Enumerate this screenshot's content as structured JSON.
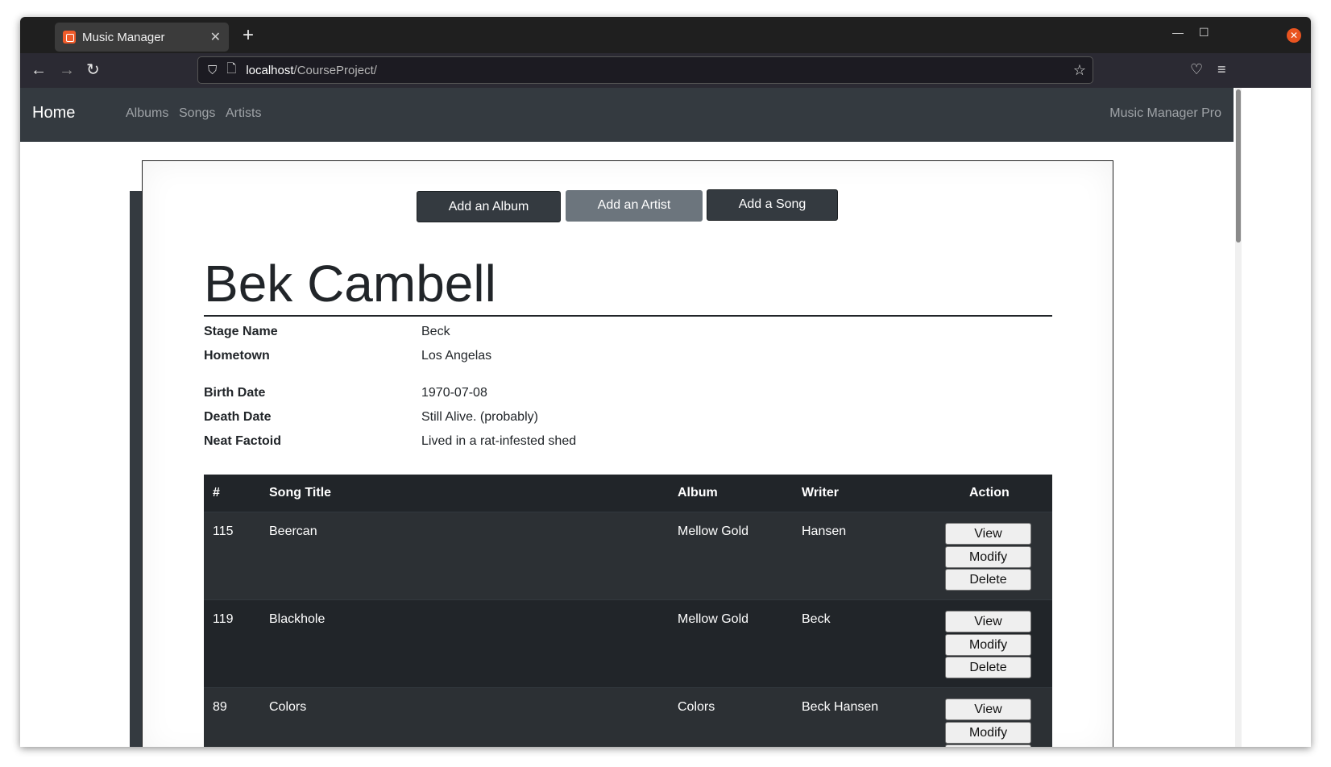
{
  "browser": {
    "tab_title": "Music Manager",
    "url_host": "localhost",
    "url_path": "/CourseProject/"
  },
  "site_nav": {
    "brand": "Home",
    "links": [
      "Albums",
      "Songs",
      "Artists"
    ],
    "right": "Music Manager Pro"
  },
  "actions": {
    "add_album": "Add an Album",
    "add_artist": "Add an Artist",
    "add_song": "Add a Song"
  },
  "artist": {
    "name": "Bek Cambell",
    "details": [
      {
        "label": "Stage Name",
        "value": "Beck"
      },
      {
        "label": "Hometown",
        "value": "Los Angelas"
      },
      {
        "label": "Birth Date",
        "value": "1970-07-08"
      },
      {
        "label": "Death Date",
        "value": "Still Alive. (probably)"
      },
      {
        "label": "Neat Factoid",
        "value": "Lived in a rat-infested shed"
      }
    ]
  },
  "songs_table": {
    "headers": [
      "#",
      "Song Title",
      "Album",
      "Writer",
      "Action"
    ],
    "rows": [
      {
        "id": "115",
        "title": "Beercan",
        "album": "Mellow Gold",
        "writer": "Hansen"
      },
      {
        "id": "119",
        "title": "Blackhole",
        "album": "Mellow Gold",
        "writer": "Beck"
      },
      {
        "id": "89",
        "title": "Colors",
        "album": "Colors",
        "writer": "Beck Hansen"
      }
    ],
    "row_actions": [
      "View",
      "Modify",
      "Delete"
    ]
  }
}
